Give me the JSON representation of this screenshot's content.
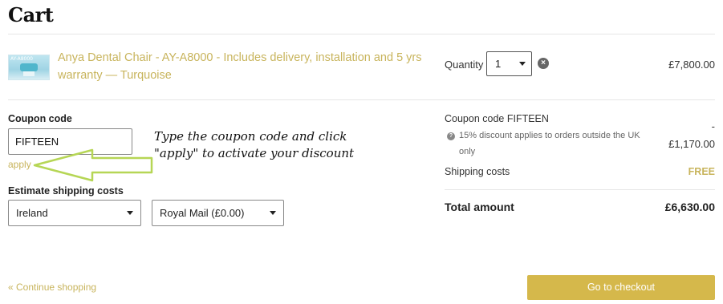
{
  "page": {
    "title": "Cart"
  },
  "item": {
    "image_alt": "AY-A8000",
    "name": "Anya Dental Chair - AY-A8000 - Includes delivery, installation and 5 yrs warranty — Turquoise",
    "quantity_label": "Quantity",
    "quantity_value": "1",
    "remove_icon": "close-circle-icon",
    "price": "£7,800.00"
  },
  "coupon": {
    "label": "Coupon code",
    "value": "FIFTEEN",
    "apply_label": "apply"
  },
  "annotation": {
    "line1": "Type the coupon code and click",
    "line2": "\"apply\" to activate your discount"
  },
  "shipping_estimate": {
    "label": "Estimate shipping costs",
    "country": "Ireland",
    "method": "Royal Mail (£0.00)"
  },
  "summary": {
    "coupon_line": "Coupon code FIFTEEN",
    "coupon_dash": "-",
    "coupon_note_line1": "15% discount applies to orders outside the UK",
    "coupon_note_line2": "only",
    "coupon_discount": "£1,170.00",
    "shipping_label": "Shipping costs",
    "shipping_value": "FREE",
    "total_label": "Total amount",
    "total_value": "£6,630.00"
  },
  "footer": {
    "continue_label": "« Continue shopping",
    "checkout_label": "Go to checkout"
  },
  "colors": {
    "accent": "#c8b45c",
    "checkout_button": "#d5b84b"
  }
}
